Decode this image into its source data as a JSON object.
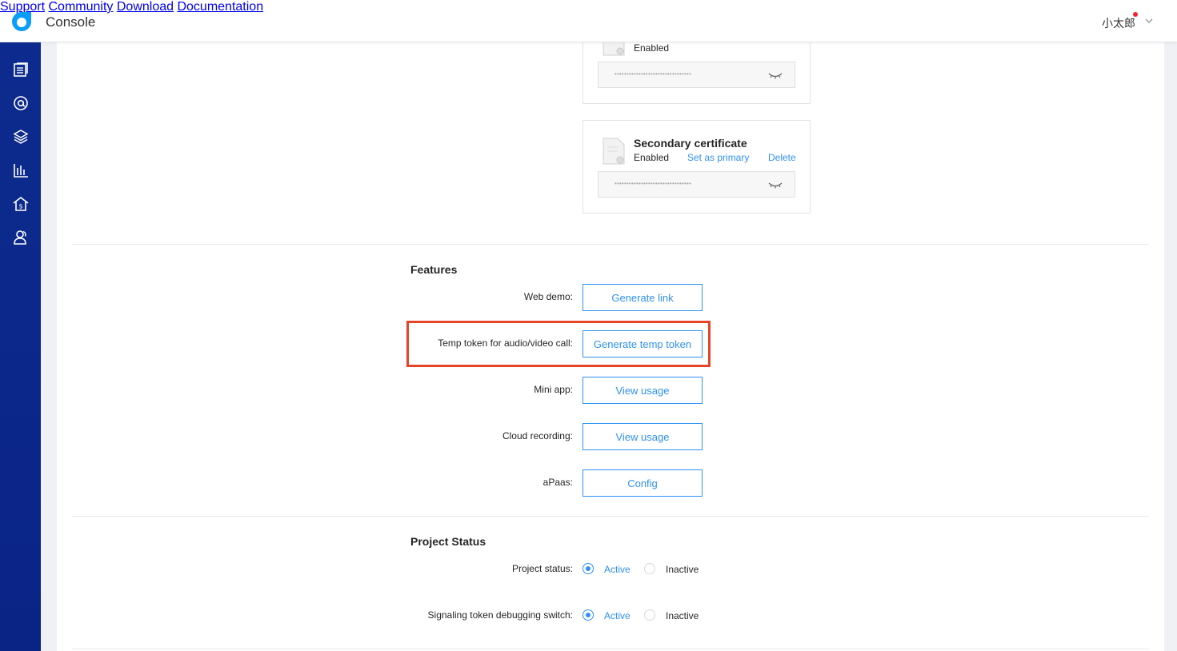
{
  "header": {
    "title": "Console",
    "nav": [
      "Support",
      "Community",
      "Download",
      "Documentation"
    ],
    "user": "小太郎"
  },
  "colors": {
    "accent": "#2f91f6",
    "sidebar": "#0d2b8e",
    "highlight": "#e5432a",
    "notification": "#f5222d"
  },
  "sidebar": {
    "icons": [
      "projects-icon",
      "at-sign-icon",
      "layers-icon",
      "bar-chart-icon",
      "billing-house-icon",
      "members-icon"
    ]
  },
  "certificates": {
    "primary": {
      "status": "Enabled",
      "secret": "••••••••••••••••••••••••••••••••"
    },
    "secondary": {
      "title": "Secondary certificate",
      "status": "Enabled",
      "set_primary": "Set as primary",
      "delete": "Delete",
      "secret": "••••••••••••••••••••••••••••••••"
    }
  },
  "features": {
    "title": "Features",
    "rows": [
      {
        "label": "Web demo:",
        "button": "Generate link"
      },
      {
        "label": "Temp token for audio/video call:",
        "button": "Generate temp token"
      },
      {
        "label": "Mini app:",
        "button": "View usage"
      },
      {
        "label": "Cloud recording:",
        "button": "View usage"
      },
      {
        "label": "aPaas:",
        "button": "Config"
      }
    ]
  },
  "project_status": {
    "title": "Project Status",
    "rows": [
      {
        "label": "Project status:",
        "active": "Active",
        "inactive": "Inactive",
        "selected": "active"
      },
      {
        "label": "Signaling token debugging switch:",
        "active": "Active",
        "inactive": "Inactive",
        "selected": "active"
      }
    ]
  }
}
